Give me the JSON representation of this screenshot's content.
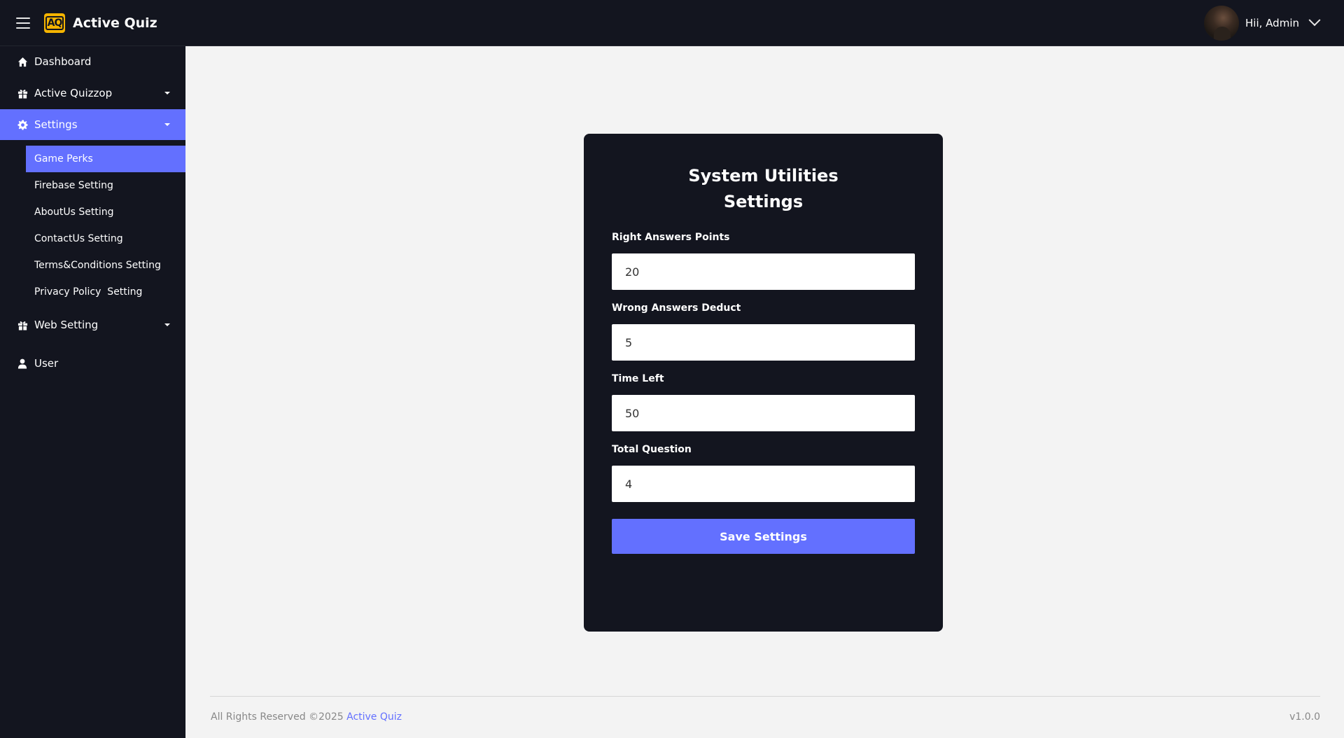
{
  "app": {
    "logo_text": "AQ",
    "title": "Active Quiz"
  },
  "header": {
    "greeting": "Hii, Admin"
  },
  "sidebar": {
    "items": [
      {
        "label": "Dashboard",
        "icon": "home-icon"
      },
      {
        "label": "Active Quizzop",
        "icon": "gift-icon"
      },
      {
        "label": "Settings",
        "icon": "gear-icon"
      },
      {
        "label": "Web Setting",
        "icon": "gift-icon"
      },
      {
        "label": "User",
        "icon": "user-icon"
      }
    ],
    "settings_sub": [
      {
        "label": "Game Perks"
      },
      {
        "label": "Firebase Setting"
      },
      {
        "label": "AboutUs Setting"
      },
      {
        "label": "ContactUs Setting"
      },
      {
        "label": "Terms&Conditions Setting"
      },
      {
        "label": "Privacy Policy  Setting"
      }
    ]
  },
  "card": {
    "title_line1": "System Utilities",
    "title_line2": "Settings",
    "fields": [
      {
        "label": "Right Answers Points",
        "value": "20"
      },
      {
        "label": "Wrong Answers Deduct",
        "value": "5"
      },
      {
        "label": "Time Left",
        "value": "50"
      },
      {
        "label": "Total Question",
        "value": "4"
      }
    ],
    "save_label": "Save Settings"
  },
  "footer": {
    "rights": "All Rights Reserved ©2025",
    "brand": "Active Quiz",
    "version": "v1.0.0"
  },
  "colors": {
    "dark": "#13151f",
    "accent": "#6370ff",
    "logo": "#f5b400",
    "background": "#f3f3f3"
  }
}
